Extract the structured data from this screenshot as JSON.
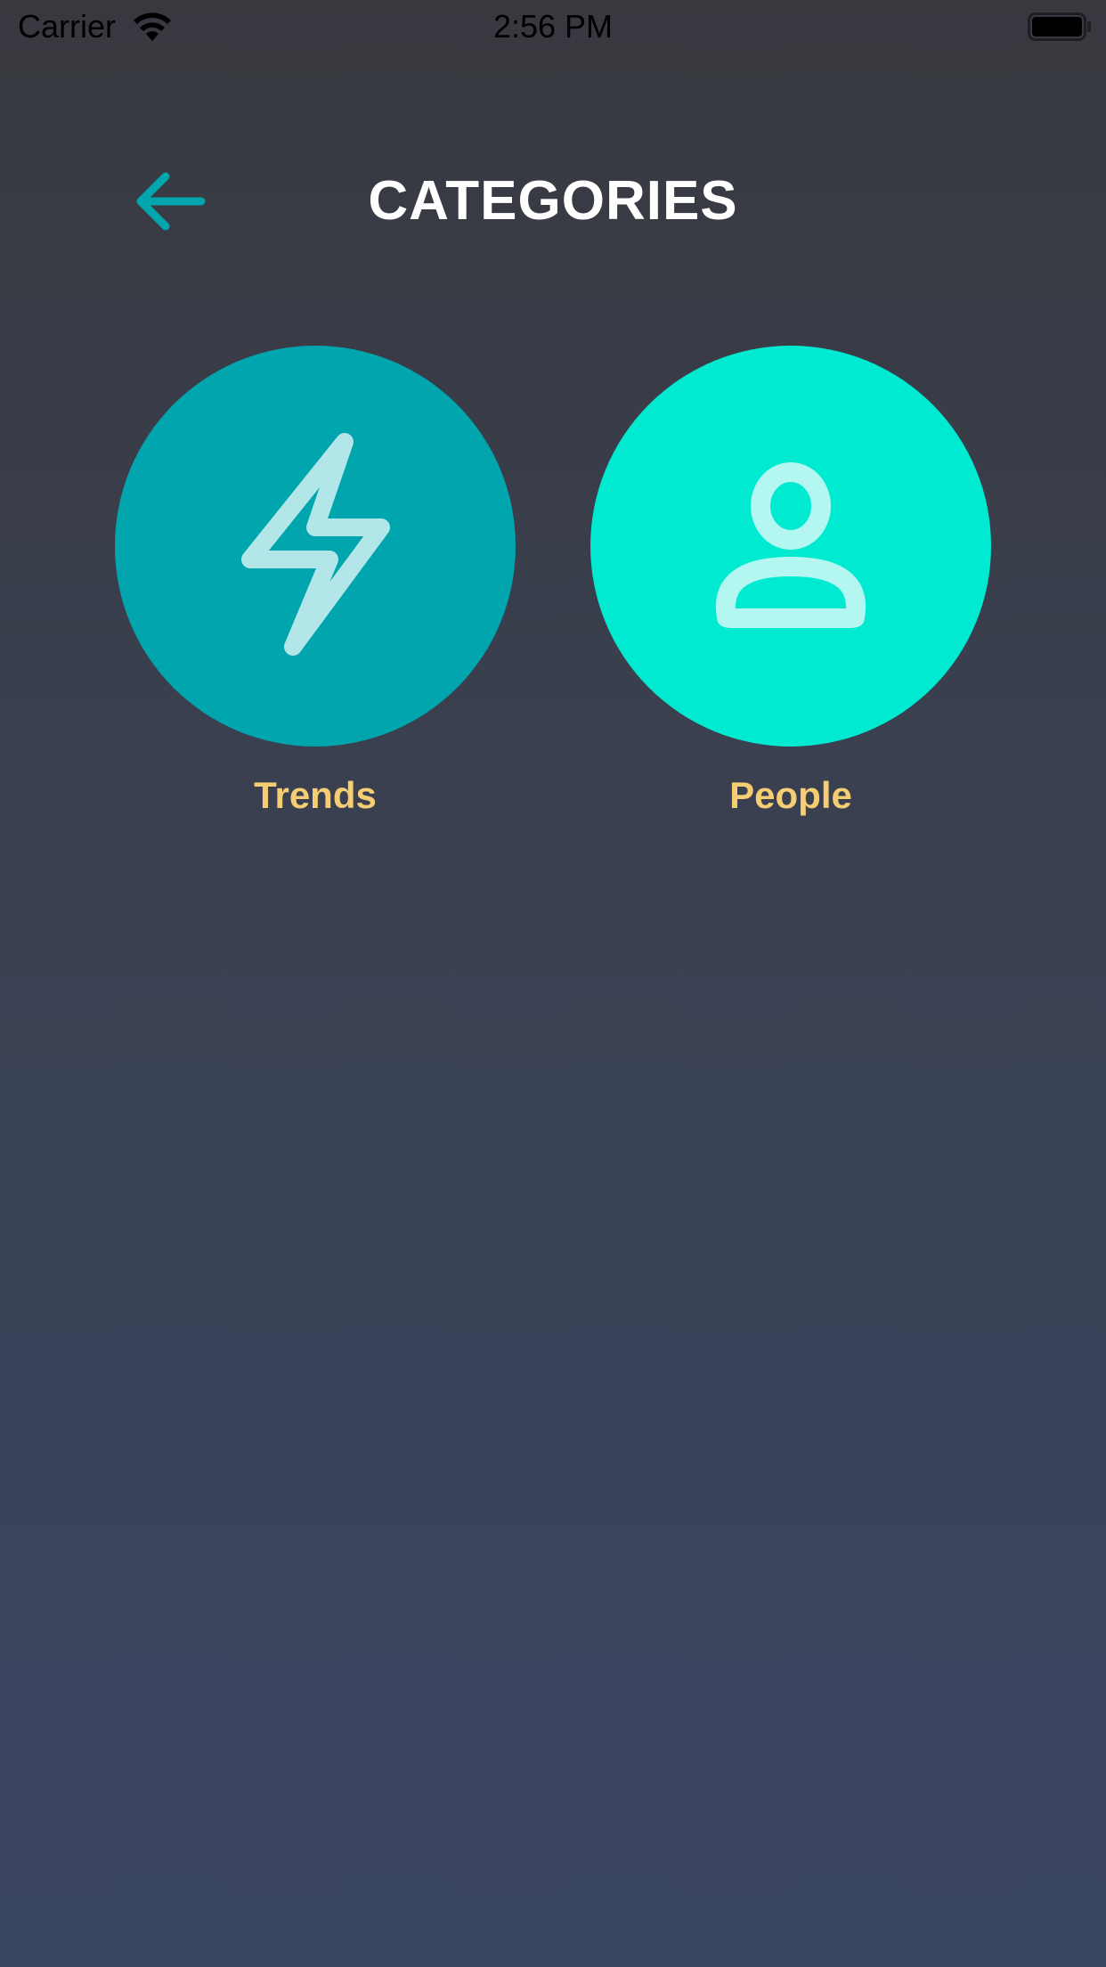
{
  "status_bar": {
    "carrier": "Carrier",
    "time": "2:56 PM",
    "wifi_icon": "wifi-icon",
    "battery_icon": "battery-icon"
  },
  "header": {
    "back_icon": "arrow-left-icon",
    "title": "CATEGORIES"
  },
  "categories": [
    {
      "label": "Trends",
      "icon": "lightning-bolt-icon",
      "circle_color": "#00a5ad",
      "icon_color": "#b3e6e8"
    },
    {
      "label": "People",
      "icon": "person-icon",
      "circle_color": "#00ead2",
      "icon_color": "#b3f7f0"
    }
  ],
  "colors": {
    "accent": "#00a5ad",
    "label": "#f5cd72",
    "title": "#ffffff",
    "background_top": "#38393f",
    "background_bottom": "#3a4562"
  }
}
